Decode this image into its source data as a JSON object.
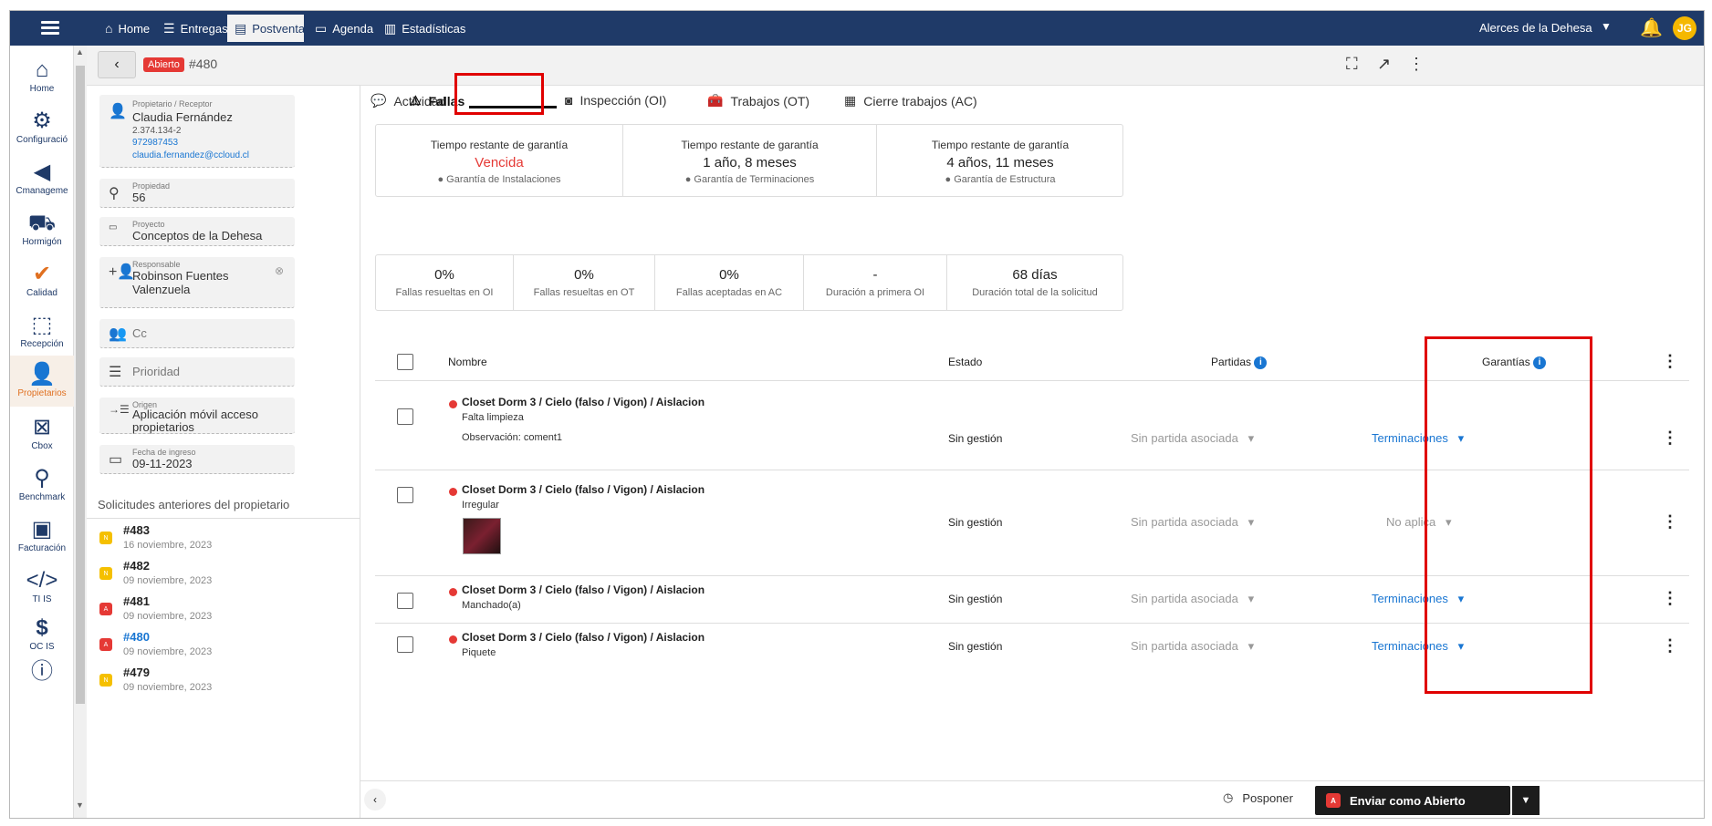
{
  "topbar": {
    "tabs": [
      {
        "label": "Home",
        "icon": "home-icon"
      },
      {
        "label": "Entregas",
        "icon": "list-icon"
      },
      {
        "label": "Postventa",
        "icon": "form-icon"
      },
      {
        "label": "Agenda",
        "icon": "calendar-icon"
      },
      {
        "label": "Estadísticas",
        "icon": "bar-chart-icon"
      }
    ],
    "company": "Alerces de la Dehesa",
    "avatar": "JG"
  },
  "leftnav": [
    {
      "label": "Home",
      "icon": "house-icon"
    },
    {
      "label": "Configuració",
      "icon": "gear-icon"
    },
    {
      "label": "Cmanageme",
      "icon": "cmanagement-icon"
    },
    {
      "label": "Hormigón",
      "icon": "wheelbarrow-icon"
    },
    {
      "label": "Calidad",
      "icon": "check-icon"
    },
    {
      "label": "Recepción",
      "icon": "reception-icon"
    },
    {
      "label": "Propietarios",
      "icon": "owner-icon"
    },
    {
      "label": "Cbox",
      "icon": "cbox-icon"
    },
    {
      "label": "Benchmark",
      "icon": "benchmark-icon"
    },
    {
      "label": "Facturación",
      "icon": "invoice-icon"
    },
    {
      "label": "TI IS",
      "icon": "code-icon"
    },
    {
      "label": "OC IS",
      "icon": "dollar-icon"
    },
    {
      "label": "",
      "icon": "help-icon"
    }
  ],
  "subheader": {
    "status": "Abierto",
    "request_number": "#480"
  },
  "owner": {
    "label": "Propietario / Receptor",
    "name": "Claudia Fernández",
    "rut": "2.374.134-2",
    "phone": "972987453",
    "email": "claudia.fernandez@ccloud.cl"
  },
  "property": {
    "label": "Propiedad",
    "value": "56"
  },
  "project": {
    "label": "Proyecto",
    "value": "Conceptos de la Dehesa"
  },
  "responsible": {
    "label": "Responsable",
    "line1": "Robinson Fuentes",
    "line2": "Valenzuela"
  },
  "cc": {
    "label": "Cc"
  },
  "priority": {
    "label": "Prioridad"
  },
  "origin": {
    "label": "Origen",
    "line1": "Aplicación móvil acceso",
    "line2": "propietarios"
  },
  "entry_date": {
    "label": "Fecha de ingreso",
    "value": "09-11-2023"
  },
  "previous": {
    "title": "Solicitudes anteriores del propietario",
    "items": [
      {
        "badge": "N",
        "color": "#f5c000",
        "number": "#483",
        "date": "16 noviembre, 2023",
        "link": false
      },
      {
        "badge": "N",
        "color": "#f5c000",
        "number": "#482",
        "date": "09 noviembre, 2023",
        "link": false
      },
      {
        "badge": "A",
        "color": "#e53935",
        "number": "#481",
        "date": "09 noviembre, 2023",
        "link": false
      },
      {
        "badge": "A",
        "color": "#e53935",
        "number": "#480",
        "date": "09 noviembre, 2023",
        "link": true
      },
      {
        "badge": "N",
        "color": "#f5c000",
        "number": "#479",
        "date": "09 noviembre, 2023",
        "link": false
      }
    ]
  },
  "tabs": [
    {
      "label": "Actividad",
      "icon": "chat-icon"
    },
    {
      "label": "Fallas",
      "icon": "warning-icon"
    },
    {
      "label": "Inspección (OI)",
      "icon": "inspection-icon"
    },
    {
      "label": "Trabajos (OT)",
      "icon": "toolbox-icon"
    },
    {
      "label": "Cierre trabajos (AC)",
      "icon": "checklist-icon"
    }
  ],
  "warranties": [
    {
      "title": "Tiempo restante de garantía",
      "value": "Vencida",
      "label": "Garantía de Instalaciones",
      "red": true
    },
    {
      "title": "Tiempo restante de garantía",
      "value": "1 año, 8 meses",
      "label": "Garantía de Terminaciones",
      "red": false
    },
    {
      "title": "Tiempo restante de garantía",
      "value": "4 años, 11 meses",
      "label": "Garantía de Estructura",
      "red": false
    }
  ],
  "stats": [
    {
      "value": "0%",
      "label": "Fallas resueltas en OI"
    },
    {
      "value": "0%",
      "label": "Fallas resueltas en OT"
    },
    {
      "value": "0%",
      "label": "Fallas aceptadas en AC"
    },
    {
      "value": "-",
      "label": "Duración a primera OI"
    },
    {
      "value": "68 días",
      "label": "Duración total de la solicitud"
    }
  ],
  "table": {
    "headers": {
      "name": "Nombre",
      "status": "Estado",
      "partidas": "Partidas",
      "warranty": "Garantías"
    },
    "rows": [
      {
        "title": "Closet Dorm 3 / Cielo (falso / Vigon) / Aislacion",
        "sub": "Falta limpieza",
        "obs": "Observación: coment1",
        "status": "Sin gestión",
        "partida": "Sin partida asociada",
        "warranty": "Terminaciones"
      },
      {
        "title": "Closet Dorm 3 / Cielo (falso / Vigon) / Aislacion",
        "sub": "Irregular",
        "obs": "",
        "status": "Sin gestión",
        "partida": "Sin partida asociada",
        "warranty": "No aplica"
      },
      {
        "title": "Closet Dorm 3 / Cielo (falso / Vigon) / Aislacion",
        "sub": "Manchado(a)",
        "obs": "",
        "status": "Sin gestión",
        "partida": "Sin partida asociada",
        "warranty": "Terminaciones"
      },
      {
        "title": "Closet Dorm 3 / Cielo (falso / Vigon) / Aislacion",
        "sub": "Piquete",
        "obs": "",
        "status": "Sin gestión",
        "partida": "Sin partida asociada",
        "warranty": "Terminaciones"
      }
    ]
  },
  "footer": {
    "postpone": "Posponer",
    "send": "Enviar como Abierto",
    "send_badge": "A"
  }
}
